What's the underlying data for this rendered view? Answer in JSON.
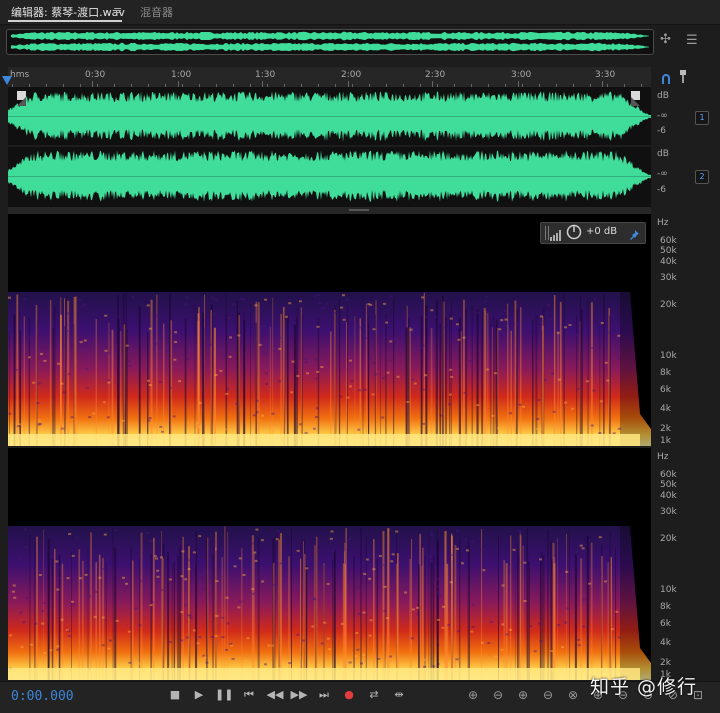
{
  "tabs": {
    "editor": "编辑器: 蔡琴-渡口.wav",
    "menu": "≡",
    "mixer": "混音器"
  },
  "ruler": {
    "unit": "hms",
    "ticks": [
      "0:30",
      "1:00",
      "1:30",
      "2:00",
      "2:30",
      "3:00",
      "3:30"
    ]
  },
  "amplitude": {
    "labels": [
      "dB",
      "-∞",
      "-6"
    ],
    "channels": [
      "1",
      "2"
    ]
  },
  "spectral": {
    "unit": "Hz",
    "labels": [
      "60k",
      "50k",
      "40k",
      "30k",
      "20k",
      "10k",
      "8k",
      "6k",
      "4k",
      "2k",
      "1k"
    ],
    "hud_gain": "+0 dB"
  },
  "transport": {
    "time": "0:00.000",
    "buttons": [
      "stop-icon",
      "play-icon",
      "pause-icon",
      "to-start-icon",
      "rewind-icon",
      "fast-forward-icon",
      "to-end-icon",
      "record-icon",
      "loop-icon",
      "skip-selection-icon"
    ],
    "zoom_buttons": [
      "zoom-in-amplitude-icon",
      "zoom-out-amplitude-icon",
      "zoom-in-time-icon",
      "zoom-out-time-icon",
      "zoom-out-full-icon",
      "zoom-in-point-icon",
      "zoom-out-point-icon",
      "zoom-selection-icon",
      "zoom-reset-icon",
      "zoom-fit-icon"
    ]
  },
  "watermark": "知乎 @修行",
  "colors": {
    "waveform": "#3fdc9a",
    "accent": "#3d86d9",
    "record": "#e43c3c"
  }
}
